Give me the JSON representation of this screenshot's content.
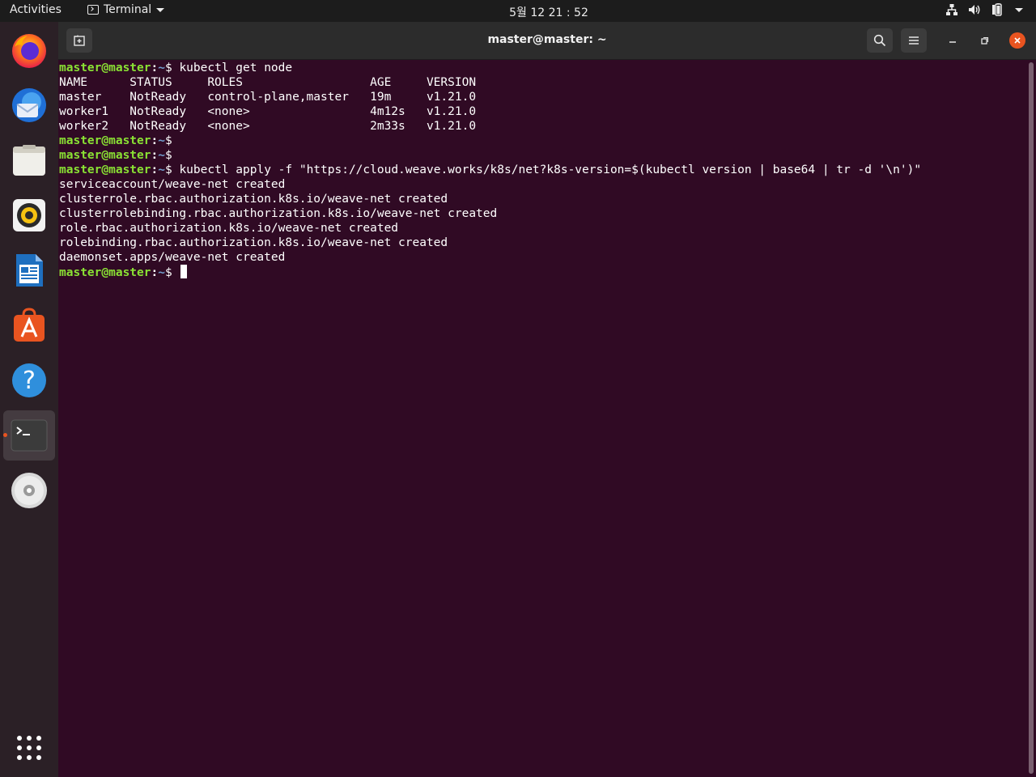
{
  "topbar": {
    "activities": "Activities",
    "app_name": "Terminal",
    "clock": "5월 12  21 : 52",
    "tray_icons": [
      "network-icon",
      "volume-icon",
      "battery-icon",
      "chevron-down-icon"
    ]
  },
  "dock": {
    "apps": [
      {
        "name": "firefox",
        "icon": "firefox-icon"
      },
      {
        "name": "thunderbird",
        "icon": "thunderbird-icon"
      },
      {
        "name": "files",
        "icon": "files-icon"
      },
      {
        "name": "rhythmbox",
        "icon": "rhythmbox-icon"
      },
      {
        "name": "libreoffice-writer",
        "icon": "writer-icon"
      },
      {
        "name": "ubuntu-software",
        "icon": "software-icon"
      },
      {
        "name": "help",
        "icon": "help-icon"
      },
      {
        "name": "terminal",
        "icon": "terminal-icon",
        "active": true
      },
      {
        "name": "dvd",
        "icon": "disc-icon"
      }
    ],
    "show_apps_icon": "app-grid-icon"
  },
  "window": {
    "title": "master@master: ~",
    "buttons": [
      "new-tab-icon",
      "search-icon",
      "hamburger-menu-icon",
      "minimize-icon",
      "maximize-icon",
      "close-icon"
    ]
  },
  "terminal": {
    "prompt_user": "master@master",
    "prompt_colon": ":",
    "prompt_path": "~",
    "prompt_symbol": "$ ",
    "lines": [
      {
        "prompt": true,
        "text": "kubectl get node"
      },
      {
        "prompt": false,
        "text": "NAME      STATUS     ROLES                  AGE     VERSION"
      },
      {
        "prompt": false,
        "text": "master    NotReady   control-plane,master   19m     v1.21.0"
      },
      {
        "prompt": false,
        "text": "worker1   NotReady   <none>                 4m12s   v1.21.0"
      },
      {
        "prompt": false,
        "text": "worker2   NotReady   <none>                 2m33s   v1.21.0"
      },
      {
        "prompt": true,
        "text": ""
      },
      {
        "prompt": true,
        "text": ""
      },
      {
        "prompt": true,
        "text": "kubectl apply -f \"https://cloud.weave.works/k8s/net?k8s-version=$(kubectl version | base64 | tr -d '\\n')\""
      },
      {
        "prompt": false,
        "text": "serviceaccount/weave-net created"
      },
      {
        "prompt": false,
        "text": "clusterrole.rbac.authorization.k8s.io/weave-net created"
      },
      {
        "prompt": false,
        "text": "clusterrolebinding.rbac.authorization.k8s.io/weave-net created"
      },
      {
        "prompt": false,
        "text": "role.rbac.authorization.k8s.io/weave-net created"
      },
      {
        "prompt": false,
        "text": "rolebinding.rbac.authorization.k8s.io/weave-net created"
      },
      {
        "prompt": false,
        "text": "daemonset.apps/weave-net created"
      },
      {
        "prompt": true,
        "text": "",
        "cursor": true
      }
    ]
  },
  "colors": {
    "terminal_bg": "#300a24",
    "prompt_user": "#8ae234",
    "prompt_path": "#729fcf",
    "accent": "#e95420"
  }
}
